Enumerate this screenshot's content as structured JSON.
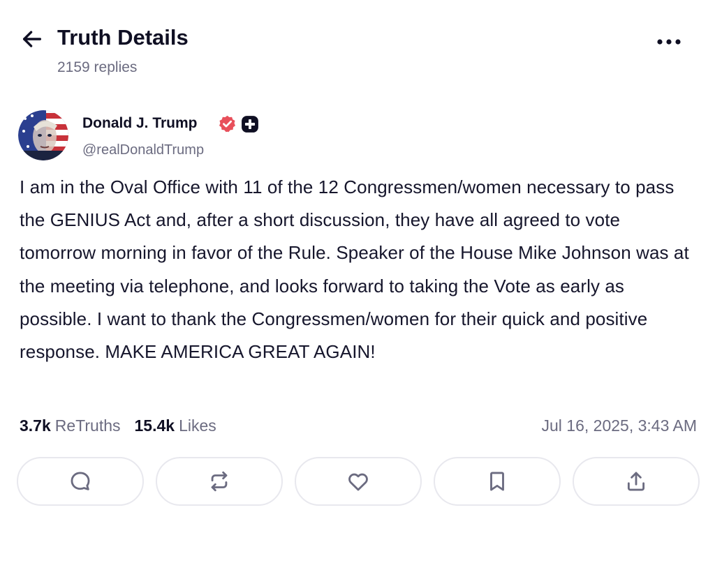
{
  "header": {
    "title": "Truth Details",
    "replies": "2159 replies",
    "back_icon": "arrow-left-icon",
    "more_icon": "more-horizontal-icon"
  },
  "post": {
    "author": {
      "name": "Donald J. Trump",
      "handle": "@realDonaldTrump",
      "avatar": "avatar-flag-face",
      "verified_color": "#e8505b"
    },
    "text": "I am in the Oval Office with 11 of the 12 Congressmen/women necessary to pass the GENIUS Act and, after a short discussion, they have all agreed to vote tomorrow morning in favor of the Rule. Speaker of the House Mike Johnson was at the meeting via telephone, and looks forward to taking the Vote as early as possible. I want to thank the Congressmen/women for their quick and positive response. MAKE AMERICA GREAT AGAIN!",
    "stats": {
      "retruths_count": "3.7k",
      "retruths_label": "ReTruths",
      "likes_count": "15.4k",
      "likes_label": "Likes"
    },
    "timestamp": "Jul 16, 2025, 3:43 AM"
  },
  "actions": [
    {
      "name": "reply",
      "icon": "comment-icon"
    },
    {
      "name": "retruth",
      "icon": "repost-icon"
    },
    {
      "name": "like",
      "icon": "heart-icon"
    },
    {
      "name": "bookmark",
      "icon": "bookmark-icon"
    },
    {
      "name": "share",
      "icon": "share-icon"
    }
  ],
  "colors": {
    "text": "#0f0f23",
    "muted": "#6b6b80",
    "border": "#e8e8ee",
    "verified": "#e8505b"
  }
}
